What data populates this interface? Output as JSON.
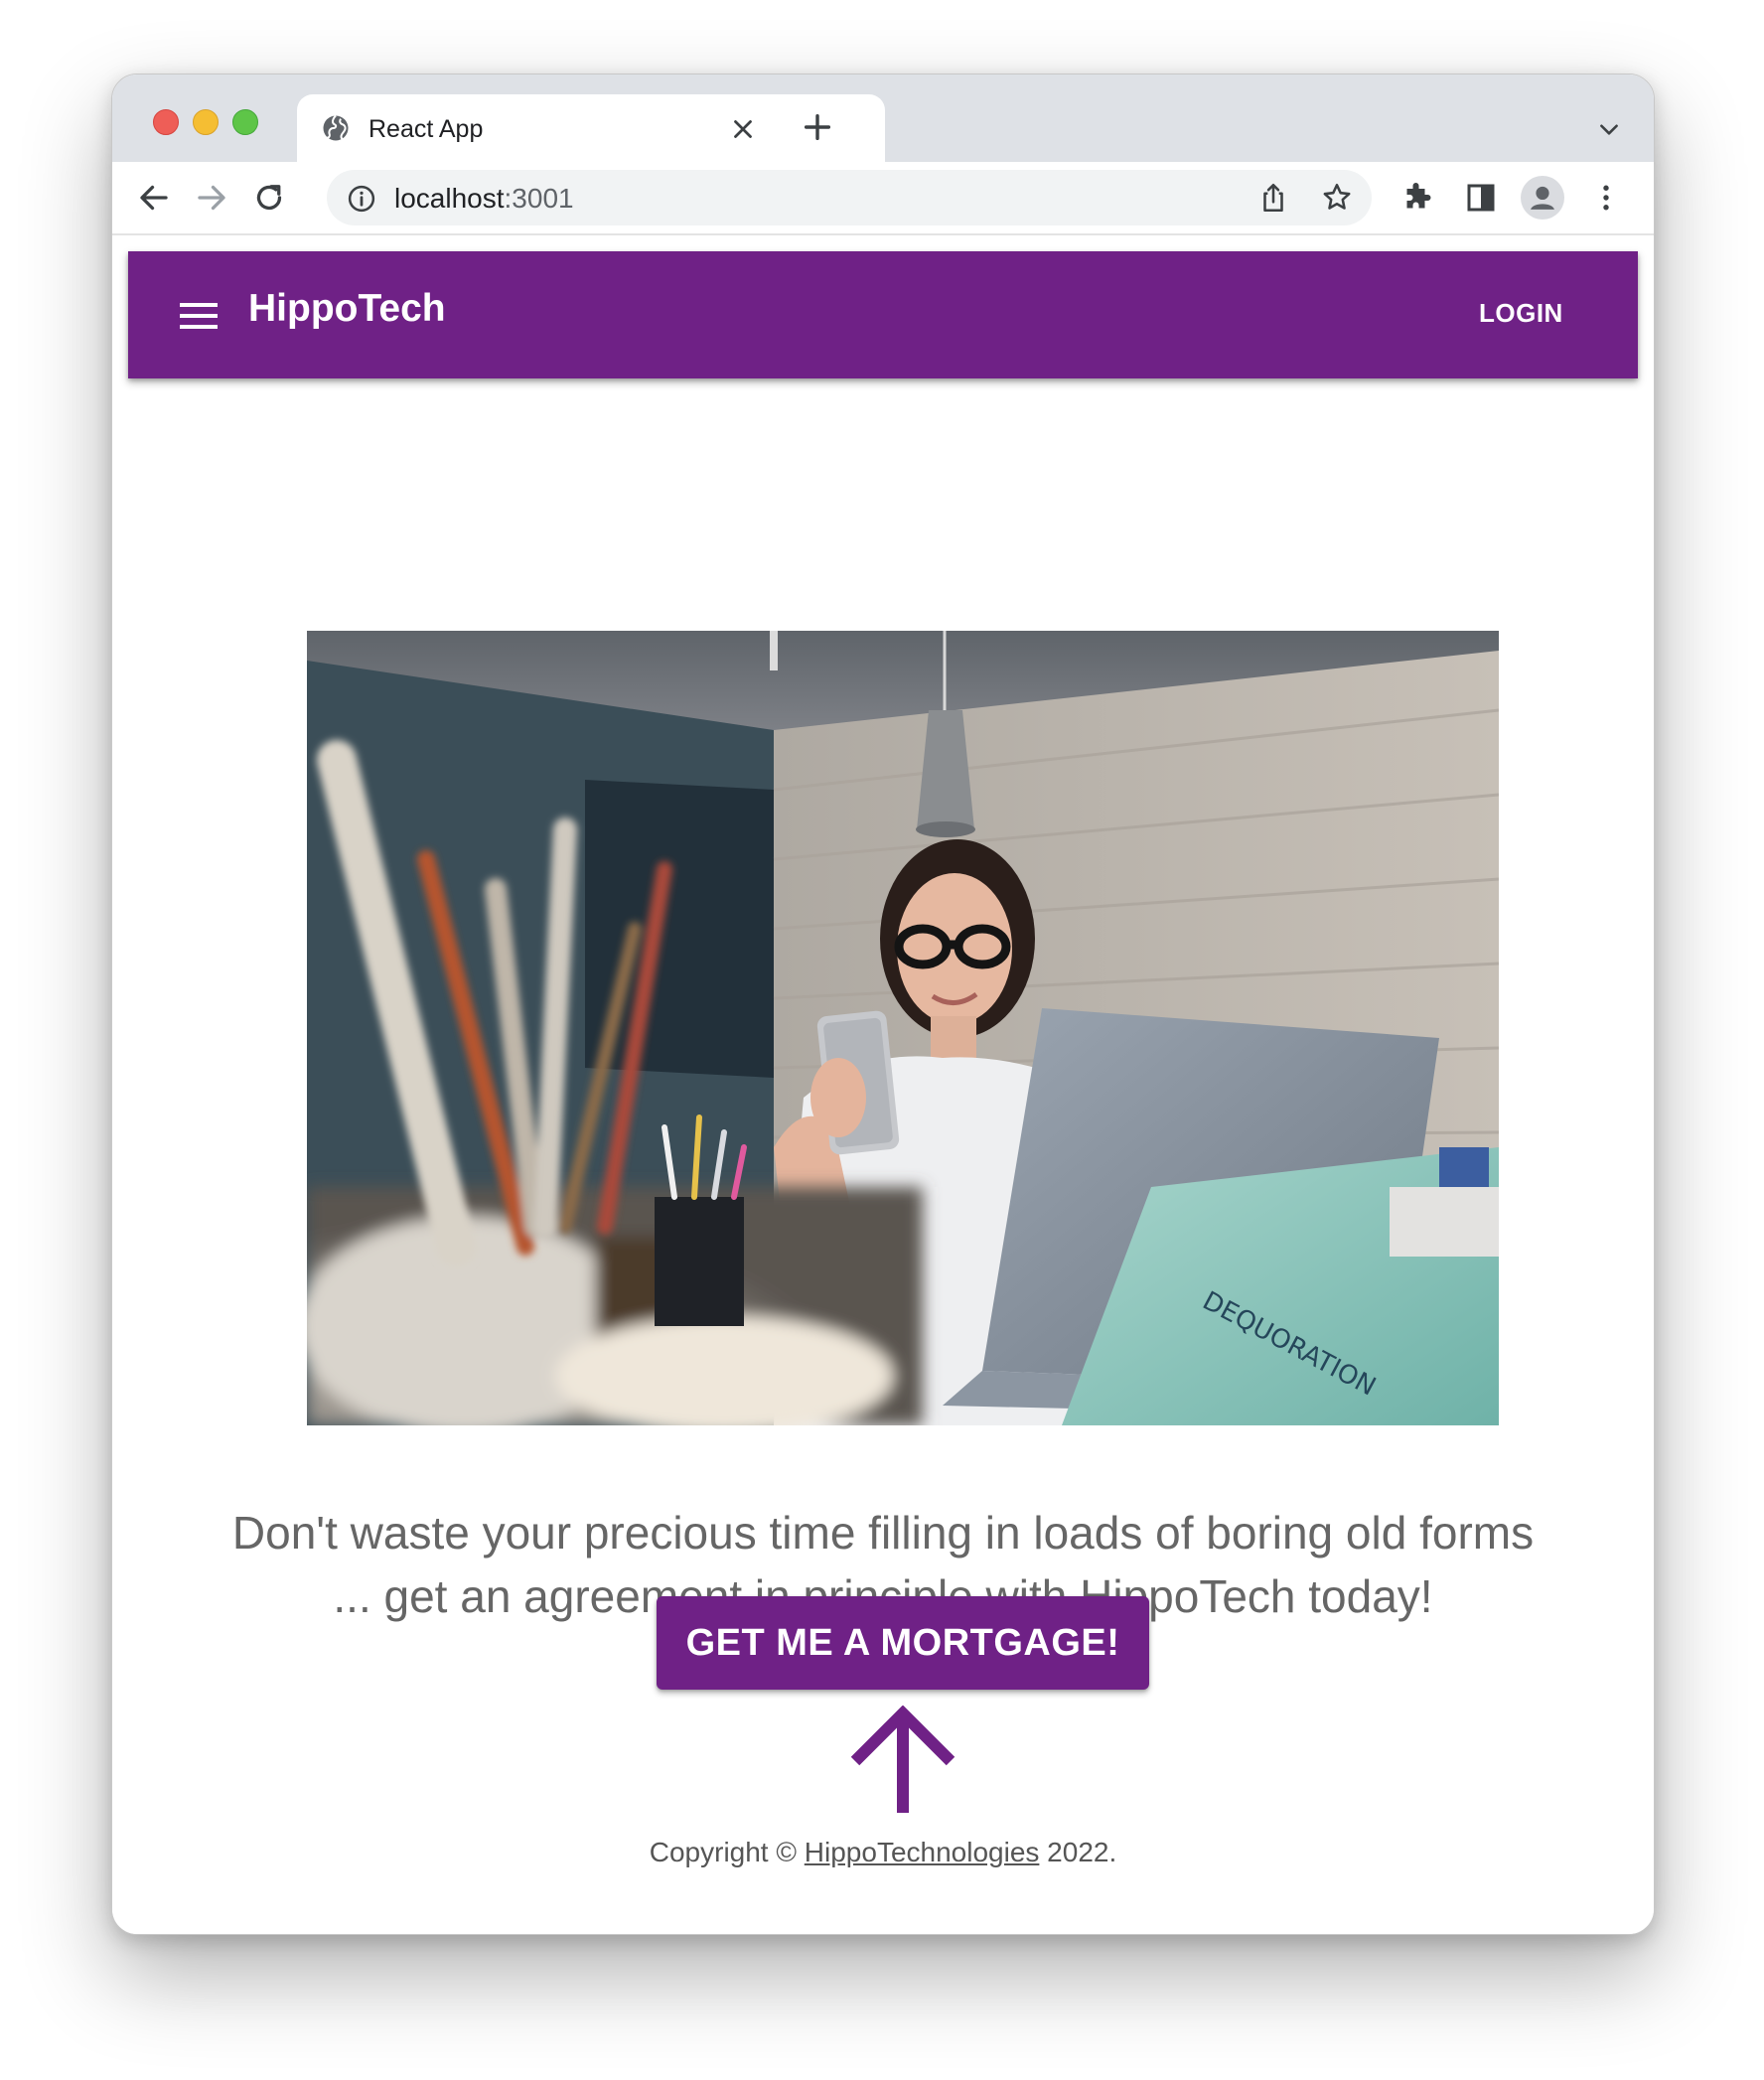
{
  "browser": {
    "tab_title": "React App",
    "url_host": "localhost",
    "url_port": ":3001"
  },
  "appbar": {
    "brand": "HippoTech",
    "login_label": "LOGIN",
    "color": "#6f2186"
  },
  "main": {
    "hero_image": "woman-with-phone-and-laptop-photo",
    "tagline": "Don't waste your precious time filling in loads of boring old forms ... get an agreement in principle with HippoTech today!",
    "cta_label": "GET ME A MORTGAGE!"
  },
  "footer": {
    "copyright_prefix": "Copyright ©",
    "copyright_link": "HippoTechnologies",
    "copyright_suffix": "2022."
  }
}
